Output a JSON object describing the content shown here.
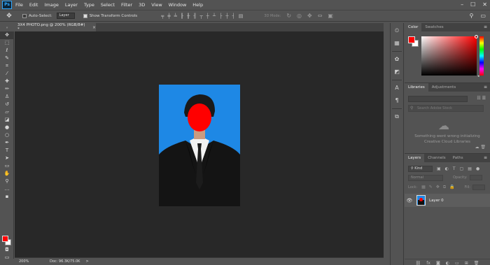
{
  "app": {
    "logo": "Ps"
  },
  "menu": [
    "File",
    "Edit",
    "Image",
    "Layer",
    "Type",
    "Select",
    "Filter",
    "3D",
    "View",
    "Window",
    "Help"
  ],
  "window_controls": {
    "minimize": "–",
    "restore": "☐",
    "close": "✕"
  },
  "options": {
    "auto_select_label": "Auto-Select:",
    "auto_select_value": "Layer",
    "transform_label": "Show Transform Controls",
    "mode3d_label": "3D Mode:"
  },
  "document": {
    "tab_title": "3X4 PHOTO.png @ 200% (RGB/8#) *",
    "tab_close": "×"
  },
  "status": {
    "zoom": "200%",
    "doc_info": "Doc: 96.3K/75.0K",
    "arrow": ">"
  },
  "panels": {
    "color": {
      "tabs": [
        "Color",
        "Swatches"
      ],
      "fg_color": "#ff0000",
      "bg_color": "#ffffff"
    },
    "libraries": {
      "tabs": [
        "Libraries",
        "Adjustments"
      ],
      "search_placeholder": "Search Adobe Stock",
      "error_line1": "Something went wrong initializing",
      "error_line2": "Creative Cloud Libraries"
    },
    "layers": {
      "tabs": [
        "Layers",
        "Channels",
        "Paths"
      ],
      "filter": "Kind",
      "blend_mode": "Normal",
      "opacity_label": "Opacity:",
      "lock_label": "Lock:",
      "fill_label": "Fill:",
      "items": [
        {
          "name": "Layer 0"
        }
      ]
    }
  },
  "colors": {
    "accent": "#31a8ff",
    "photo_bg": "#1e88e5",
    "face_fill": "#ff0000"
  }
}
